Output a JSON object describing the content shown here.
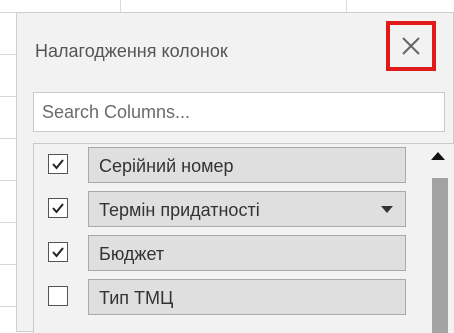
{
  "panel": {
    "title": "Налагодження колонок"
  },
  "search": {
    "placeholder": "Search Columns..."
  },
  "columns": [
    {
      "label": "Серійний номер",
      "checked": true,
      "has_dropdown": false
    },
    {
      "label": "Термін придатності",
      "checked": true,
      "has_dropdown": true
    },
    {
      "label": "Бюджет",
      "checked": true,
      "has_dropdown": false
    },
    {
      "label": "Тип ТМЦ",
      "checked": false,
      "has_dropdown": false
    }
  ],
  "icons": {
    "close": "close-icon",
    "check": "checkmark-icon",
    "dropdown": "chevron-down-icon",
    "scroll_up": "scroll-up-arrow-icon"
  },
  "colors": {
    "highlight": "#e01919",
    "panel_bg": "#f2f2f2",
    "label_bg": "#dfdfdf"
  }
}
